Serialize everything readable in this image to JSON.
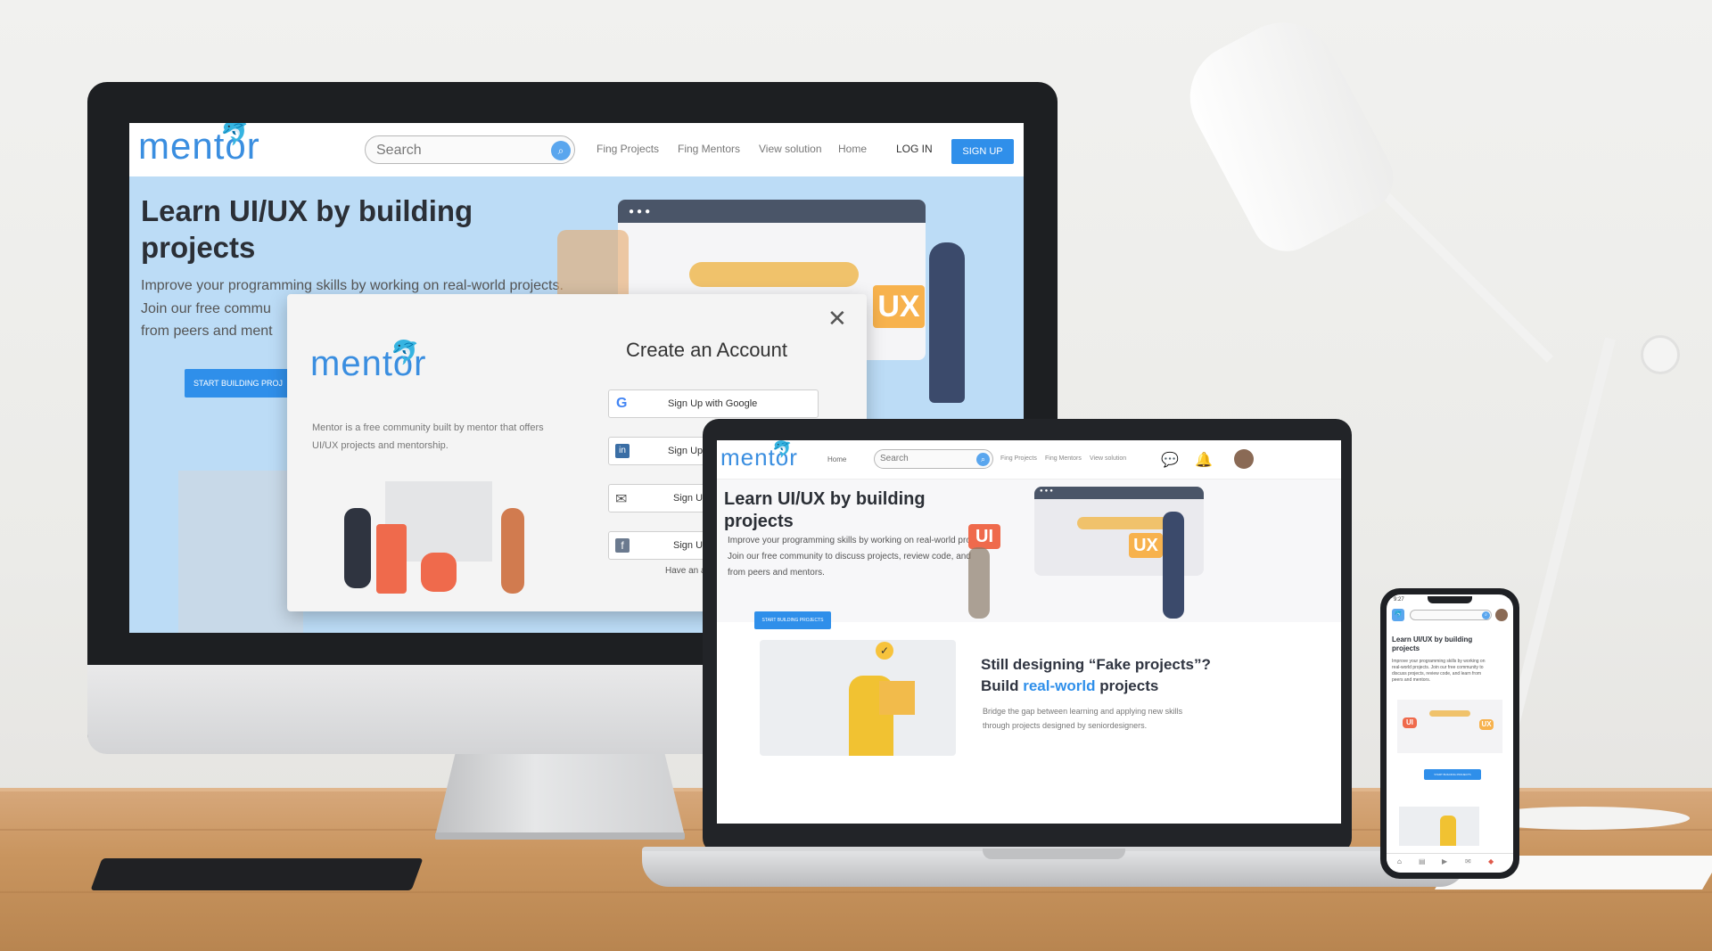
{
  "monitor": {
    "nav": {
      "logo": "mentor",
      "search_placeholder": "Search",
      "links": [
        "Fing Projects",
        "Fing Mentors",
        "View solution",
        "Home"
      ],
      "login": "LOG IN",
      "signup": "SIGN UP"
    },
    "hero": {
      "title_line1": "Learn UI/UX by building",
      "title_line2": "projects",
      "text_line1": "Improve your programming skills by working on real-world projects.",
      "text_line2": "Join our free commu",
      "text_line3": "from peers and ment",
      "cta": "START BUILDING PROJ",
      "badge": "UX"
    },
    "modal": {
      "logo": "mentor",
      "description_line1": "Mentor is a free community built by mentor that offers",
      "description_line2": "UI/UX projects and mentorship.",
      "title": "Create an Account",
      "google": "Sign Up with Google",
      "linkedin": "Sign Up",
      "email": "Sign Up",
      "facebook": "Sign Up",
      "footer": "Have an a"
    }
  },
  "laptop": {
    "nav": {
      "logo": "mentor",
      "home": "Home",
      "search_placeholder": "Search",
      "links": [
        "Fing Projects",
        "Fing Mentors",
        "View solution"
      ]
    },
    "hero": {
      "title_line1": "Learn UI/UX by building",
      "title_line2": "projects",
      "text_line1": "Improve your programming skills by working on real-world pro",
      "text_line2": "Join our free community to discuss projects, review code, and",
      "text_line3": "from peers and mentors.",
      "cta": "START BUILDING PROJECTS",
      "badge_ui": "UI",
      "badge_ux": "UX"
    },
    "section2": {
      "title_line1": "Still designing “Fake projects”?",
      "title_prefix": "Build ",
      "title_highlight": "real-world",
      "title_suffix": " projects",
      "text_line1": "Bridge the gap between learning and applying new skills",
      "text_line2": "through projects designed by seniordesigners."
    }
  },
  "phone": {
    "time": "9:27",
    "title_line1": "Learn UI/UX by building",
    "title_line2": "projects",
    "text": "Improve your programming skills by working on real-world projects. Join our free community to discuss projects, review code, and learn from peers and mentors.",
    "cta": "START BUILDING PROJECTS",
    "badge_ui": "UI",
    "badge_ux": "UX"
  },
  "colors": {
    "brand_blue": "#2f8fea",
    "hero_bg": "#bcdcf6",
    "accent_orange": "#f7b24d"
  }
}
